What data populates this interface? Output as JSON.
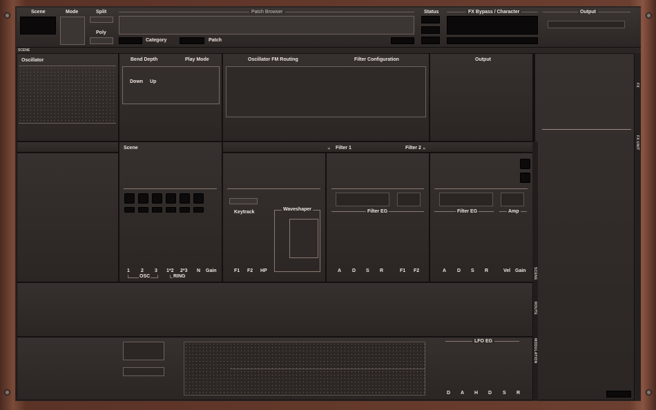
{
  "header": {
    "scene": "Scene",
    "mode": "Mode",
    "split": "Split",
    "poly": "Poly",
    "patch_browser": "Patch Browser",
    "category": "Category",
    "patch": "Patch",
    "status": "Status",
    "fx_bypass": "FX Bypass / Character",
    "output": "Output"
  },
  "scene_tag": "SCENE",
  "top_row": {
    "oscillator": "Oscillator",
    "bend_depth": "Bend Depth",
    "play_mode": "Play Mode",
    "down": "Down",
    "up": "Up",
    "fm_routing": "Oscillator FM Routing",
    "filter_config": "Filter Configuration",
    "output": "Output"
  },
  "mid_row": {
    "scene": "Scene",
    "filter1": "Filter 1",
    "filter2": "Filter 2",
    "keytrack": "Keytrack",
    "waveshaper": "Waveshaper",
    "filter_eg_1": "Filter EG",
    "filter_eg_2": "Filter EG",
    "amp": "Amp",
    "mixer_labels": [
      "1",
      "2",
      "3",
      "1*2",
      "2*3",
      "N",
      "Gain"
    ],
    "osc": "OSC",
    "ring": "RING",
    "filter_labels": [
      "F1",
      "F2",
      "HP"
    ],
    "eg1_labels": [
      "A",
      "D",
      "S",
      "R",
      "F1",
      "F2"
    ],
    "eg2_labels": [
      "A",
      "D",
      "S",
      "R",
      "Vel",
      "Gain"
    ]
  },
  "side_tabs": {
    "fx": "FX",
    "fx_unit": "FX UNIT",
    "scene": "SCENE",
    "route": "ROUTE",
    "modulation": "MODULATION"
  },
  "bottom_row": {
    "lfo_eg": "LFO EG",
    "env_labels": [
      "D",
      "A",
      "H",
      "D",
      "S",
      "R"
    ]
  }
}
